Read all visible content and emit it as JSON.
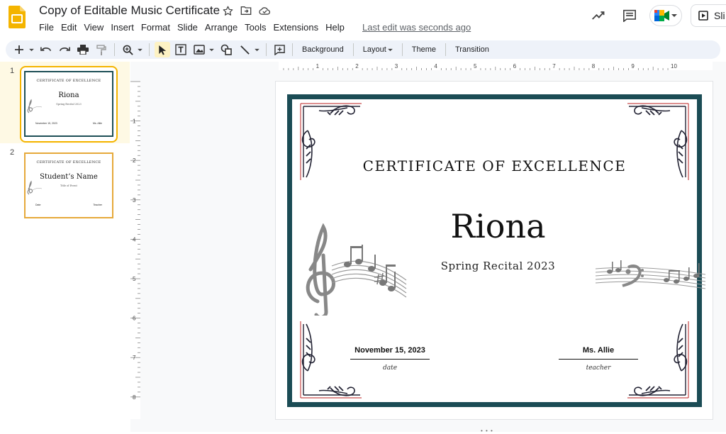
{
  "app": {
    "doc_title": "Copy of Editable Music Certificate",
    "last_edit": "Last edit was seconds ago",
    "slideshow_label": "Sli"
  },
  "menu": [
    "File",
    "Edit",
    "View",
    "Insert",
    "Format",
    "Slide",
    "Arrange",
    "Tools",
    "Extensions",
    "Help"
  ],
  "toolbar": {
    "background_label": "Background",
    "layout_label": "Layout",
    "theme_label": "Theme",
    "transition_label": "Transition"
  },
  "ruler": {
    "top_ticks": [
      "1",
      "2",
      "3",
      "4",
      "5",
      "6",
      "7",
      "8",
      "9",
      "10"
    ],
    "left_ticks": [
      "1",
      "2",
      "3",
      "4",
      "5",
      "6",
      "7",
      "8"
    ]
  },
  "slides": [
    {
      "number": "1",
      "heading": "CERTIFICATE OF EXCELLENCE",
      "name": "Riona",
      "subtitle": "Spring Recital 2023",
      "date": "November 15, 2023",
      "teacher": "Ms. Allie"
    },
    {
      "number": "2",
      "heading": "CERTIFICATE OF EXCELLENCE",
      "name": "Student’s Name",
      "subtitle": "Title of Event",
      "date": "Date",
      "teacher": "Teacher"
    }
  ],
  "certificate": {
    "heading": "CERTIFICATE OF EXCELLENCE",
    "name": "Riona",
    "subtitle": "Spring Recital 2023",
    "date_value": "November 15, 2023",
    "date_label": "date",
    "teacher_value": "Ms. Allie",
    "teacher_label": "teacher"
  },
  "colors": {
    "frame": "#1b4c55",
    "frame_gold": "#e6a93a",
    "selection": "#f4b400",
    "toolbar_bg": "#eef2f9"
  },
  "icons": [
    "slides-logo-icon",
    "star-icon",
    "move-to-folder-icon",
    "cloud-saved-icon",
    "activity-trend-icon",
    "comment-icon",
    "meet-icon",
    "present-icon"
  ]
}
